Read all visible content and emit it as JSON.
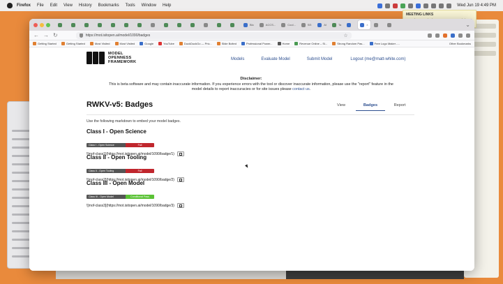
{
  "menubar": {
    "app": "Firefox",
    "items": [
      "File",
      "Edit",
      "View",
      "History",
      "Bookmarks",
      "Tools",
      "Window",
      "Help"
    ],
    "clock": "Wed Jun 19 4:49 PM"
  },
  "note_card": {
    "title": "MEETING LINKS",
    "body": "Sample note: 2/14/2024 PM, 2024 pm 5/3/2024"
  },
  "browser": {
    "tabs": [
      {
        "label": "",
        "icon": "green"
      },
      {
        "label": "",
        "icon": "green"
      },
      {
        "label": "",
        "icon": "green"
      },
      {
        "label": "",
        "icon": "green"
      },
      {
        "label": "",
        "icon": "green"
      },
      {
        "label": "",
        "icon": "green"
      },
      {
        "label": "",
        "icon": "green"
      },
      {
        "label": "",
        "icon": "grey"
      },
      {
        "label": "",
        "icon": "green"
      },
      {
        "label": "",
        "icon": "green"
      },
      {
        "label": "",
        "icon": "green"
      },
      {
        "label": "",
        "icon": "grey"
      },
      {
        "label": "",
        "icon": "green"
      },
      {
        "label": "",
        "icon": "green"
      },
      {
        "label": "Blo",
        "icon": "blue"
      },
      {
        "label": "ACCS...",
        "icon": "grey"
      },
      {
        "label": "Cool...",
        "icon": "grey"
      },
      {
        "label": "SE:",
        "icon": "grey"
      },
      {
        "label": "AI",
        "icon": "blue"
      },
      {
        "label": "Ta",
        "icon": "green"
      },
      {
        "label": "",
        "icon": "blue"
      },
      {
        "label": "×",
        "icon": "blue",
        "active": true
      },
      {
        "label": "",
        "icon": "grey"
      },
      {
        "label": "",
        "icon": "grey"
      }
    ],
    "url": "https://mot.isitopen.ai/model/1090/badges",
    "bookmarks": [
      {
        "label": "Getting Started",
        "icon": "orange"
      },
      {
        "label": "Getting Started",
        "icon": "orange"
      },
      {
        "label": "Most Visited",
        "icon": "orange"
      },
      {
        "label": "Most Visited",
        "icon": "orange"
      },
      {
        "label": "Google",
        "icon": "blue"
      },
      {
        "label": "YouTube",
        "icon": "red"
      },
      {
        "label": "DuckDuckGo — Priv...",
        "icon": "orange"
      },
      {
        "label": "Slide Bolted",
        "icon": "orange"
      },
      {
        "label": "Professional Power...",
        "icon": "blue"
      },
      {
        "label": "Home",
        "icon": "dark"
      },
      {
        "label": "Revenue Online – Si...",
        "icon": "green"
      },
      {
        "label": "Strong Random Pas...",
        "icon": "orange"
      },
      {
        "label": "Free Logo Maker -...",
        "icon": "blue"
      }
    ],
    "other_bookmarks": "Other Bookmarks"
  },
  "site": {
    "logo_lines": [
      "MODEL",
      "OPENNESS",
      "FRAMEWORK"
    ],
    "nav": {
      "models": "Models",
      "evaluate": "Evaluate Model",
      "submit": "Submit Model",
      "logout": "Logout (me@matt-white.com)"
    },
    "disclaimer": {
      "title": "Disclaimer:",
      "line1": "This is beta software and may contain inaccurate information. If you experience errors with the tool or discover inaccurate information, please use the \"report\" feature in the",
      "line2_prefix": "model details to report inaccuracies or for site issues please",
      "line2_link": "contact us",
      "line2_suffix": "."
    },
    "page_title": "RWKV-v5: Badges",
    "view_tabs": {
      "view": "View",
      "badges": "Badges",
      "report": "Report"
    },
    "instruction": "Use the following markdown to embed your model badges.",
    "badges": [
      {
        "heading": "Class I - Open Science",
        "left": "Class I - Open Science",
        "right": "Fail",
        "right_color": "#c0262d",
        "markdown": "![mof-class1](https://mot.isitopen.ai/model/1090/badge/1)"
      },
      {
        "heading": "Class II - Open Tooling",
        "left": "Class II - Open Tooling",
        "right": "Fail",
        "right_color": "#c0262d",
        "markdown": "![mof-class2](https://mot.isitopen.ai/model/1090/badge/2)"
      },
      {
        "heading": "Class III - Open Model",
        "left": "Class III - Open Model",
        "right": "Conditional Pass",
        "right_color": "#5bc236",
        "markdown": "![mof-class3](https://mot.isitopen.ai/model/1090/badge/3)"
      }
    ]
  }
}
